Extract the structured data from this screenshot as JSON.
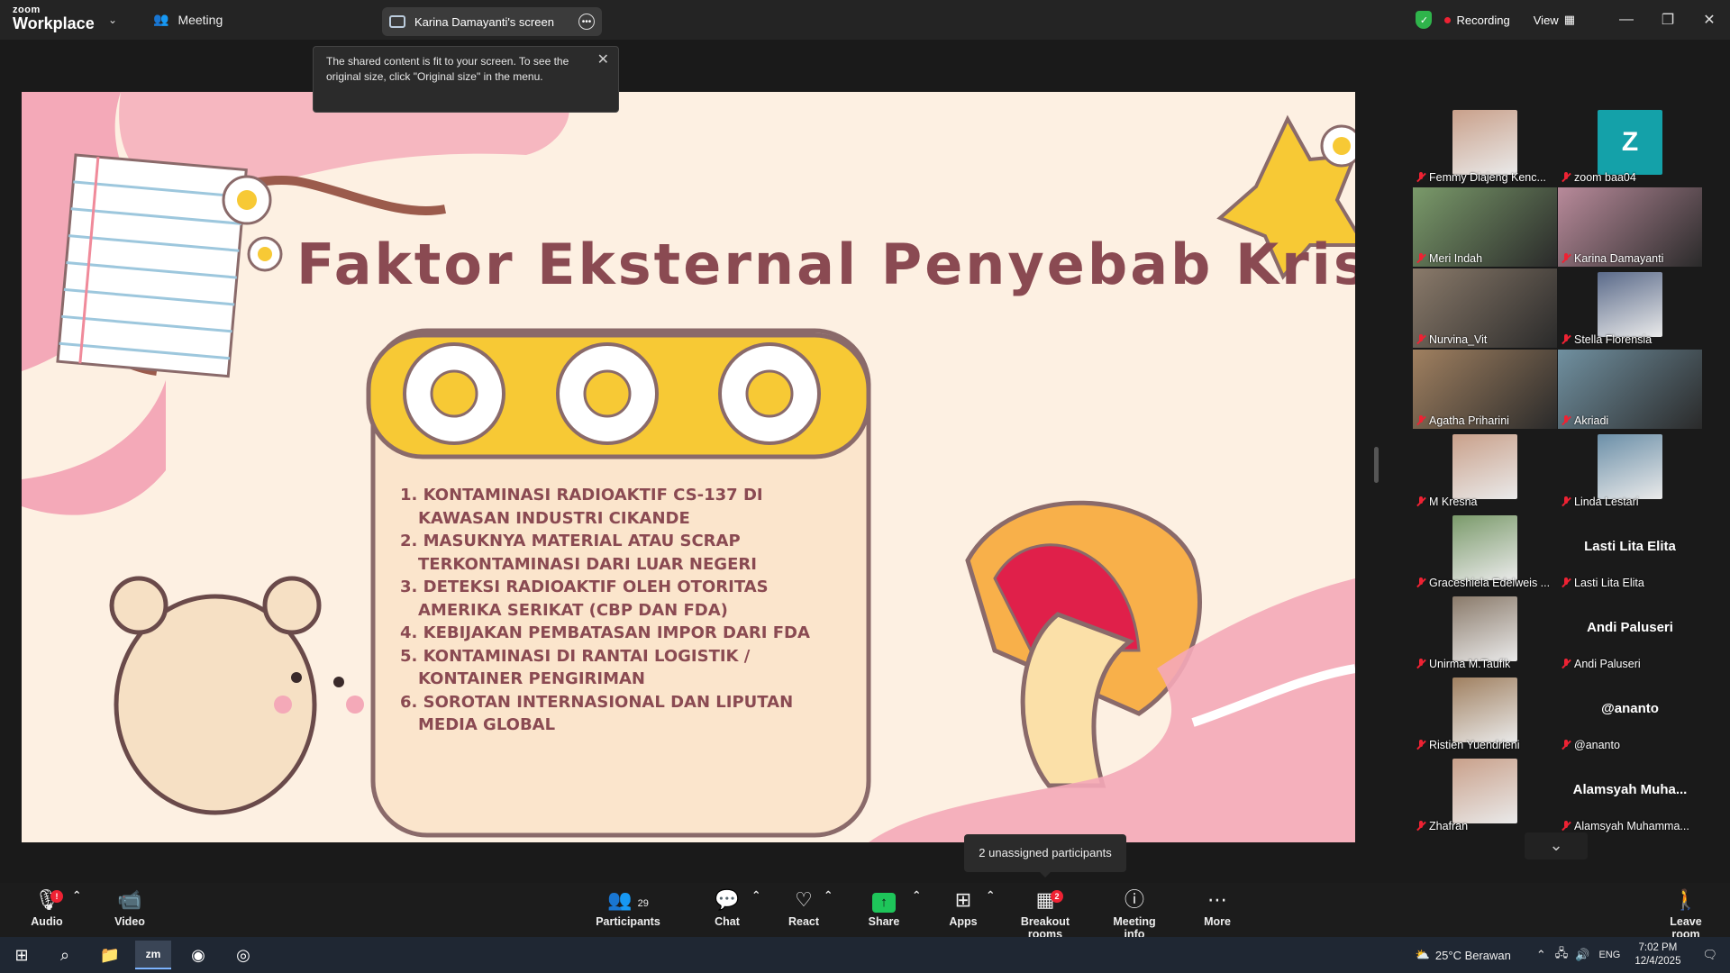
{
  "app": {
    "logo_small": "zoom",
    "logo_big": "Workplace",
    "meeting_label": "Meeting",
    "screen_tab": "Karina Damayanti's screen",
    "recording": "Recording",
    "view": "View",
    "colors": {
      "accent_green": "#2fb44b",
      "rec_red": "#e22233",
      "avatar_teal": "#14a1a9"
    }
  },
  "toast": {
    "text": "The shared content is fit to your screen. To see the original size, click \"Original size\" in the menu."
  },
  "slide": {
    "title": "Faktor Eksternal Penyebab Krisis",
    "items": [
      "1. KONTAMINASI RADIOAKTIF CS-137 DI KAWASAN INDUSTRI CIKANDE",
      "2. MASUKNYA MATERIAL ATAU SCRAP TERKONTAMINASI DARI LUAR NEGERI",
      "3. DETEKSI RADIOAKTIF OLEH OTORITAS AMERIKA SERIKAT (CBP DAN FDA)",
      "4. KEBIJAKAN PEMBATASAN IMPOR DARI FDA",
      "5. KONTAMINASI DI RANTAI LOGISTIK / KONTAINER PENGIRIMAN",
      "6. SOROTAN INTERNASIONAL DAN LIPUTAN MEDIA GLOBAL"
    ]
  },
  "participants_gallery": [
    {
      "name": "Femmy Diajeng Kenc...",
      "kind": "photo"
    },
    {
      "name": "zoom baa04",
      "kind": "letter",
      "letter": "Z"
    },
    {
      "name": "Meri Indah",
      "kind": "video",
      "active": true
    },
    {
      "name": "Karina Damayanti",
      "kind": "video"
    },
    {
      "name": "Nurvina_Vit",
      "kind": "video"
    },
    {
      "name": "Stella Florensia",
      "kind": "photo"
    },
    {
      "name": "Agatha Priharini",
      "kind": "video"
    },
    {
      "name": "Akriadi",
      "kind": "video"
    },
    {
      "name": "M Kresna",
      "kind": "photo"
    },
    {
      "name": "Linda Lestari",
      "kind": "photo"
    },
    {
      "name": "Graceshiela Edelweis ...",
      "kind": "photo"
    },
    {
      "name": "Lasti Lita Elita",
      "kind": "name",
      "big": "Lasti Lita Elita"
    },
    {
      "name": "Unirma M.Taufik",
      "kind": "photo"
    },
    {
      "name": "Andi Paluseri",
      "kind": "name",
      "big": "Andi Paluseri"
    },
    {
      "name": "Ristien Yuendrieni",
      "kind": "photo"
    },
    {
      "name": "@ananto",
      "kind": "name",
      "big": "@ananto"
    },
    {
      "name": "Zhafran",
      "kind": "photo"
    },
    {
      "name": "Alamsyah Muhamma...",
      "kind": "name",
      "big": "Alamsyah  Muha..."
    }
  ],
  "tooltip_unassigned": "2 unassigned participants",
  "toolbar": {
    "audio": "Audio",
    "video": "Video",
    "participants": "Participants",
    "participants_count": "29",
    "chat": "Chat",
    "react": "React",
    "share": "Share",
    "apps": "Apps",
    "breakout": "Breakout rooms",
    "breakout_badge": "2",
    "meeting_info": "Meeting info",
    "more": "More",
    "leave": "Leave room"
  },
  "taskbar": {
    "weather": "25°C  Berawan",
    "lang": "ENG",
    "time": "7:02 PM",
    "date": "12/4/2025"
  }
}
